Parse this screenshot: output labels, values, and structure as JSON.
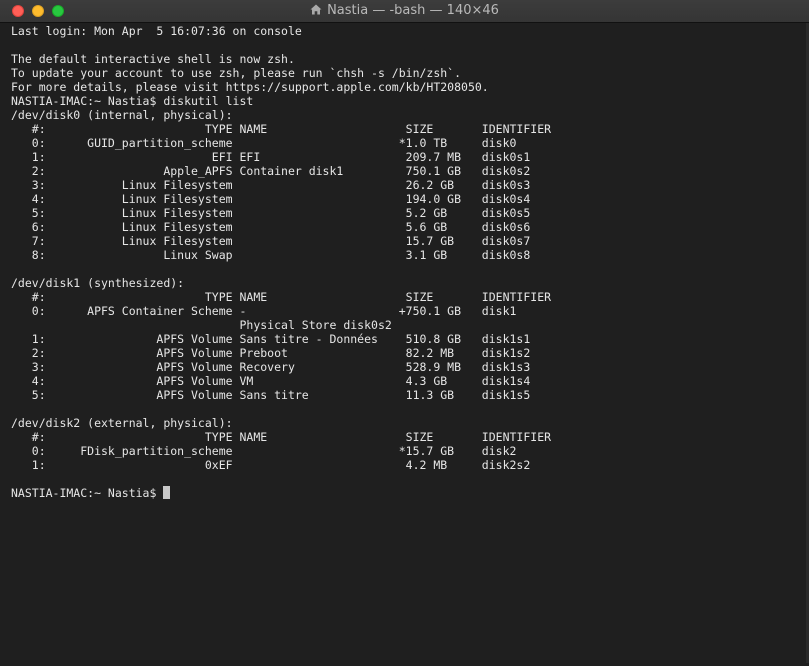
{
  "window": {
    "title": "Nastia — -bash — 140×46",
    "home_icon": "home-icon"
  },
  "terminal": {
    "lines": [
      "Last login: Mon Apr  5 16:07:36 on console",
      "",
      "The default interactive shell is now zsh.",
      "To update your account to use zsh, please run `chsh -s /bin/zsh`.",
      "For more details, please visit https://support.apple.com/kb/HT208050.",
      "NASTIA-IMAC:~ Nastia$ diskutil list",
      "/dev/disk0 (internal, physical):",
      "   #:                       TYPE NAME                    SIZE       IDENTIFIER",
      "   0:      GUID_partition_scheme                        *1.0 TB     disk0",
      "   1:                        EFI EFI                     209.7 MB   disk0s1",
      "   2:                 Apple_APFS Container disk1         750.1 GB   disk0s2",
      "   3:           Linux Filesystem                         26.2 GB    disk0s3",
      "   4:           Linux Filesystem                         194.0 GB   disk0s4",
      "   5:           Linux Filesystem                         5.2 GB     disk0s5",
      "   6:           Linux Filesystem                         5.6 GB     disk0s6",
      "   7:           Linux Filesystem                         15.7 GB    disk0s7",
      "   8:                 Linux Swap                         3.1 GB     disk0s8",
      "",
      "/dev/disk1 (synthesized):",
      "   #:                       TYPE NAME                    SIZE       IDENTIFIER",
      "   0:      APFS Container Scheme -                      +750.1 GB   disk1",
      "                                 Physical Store disk0s2",
      "   1:                APFS Volume Sans titre - Données    510.8 GB   disk1s1",
      "   2:                APFS Volume Preboot                 82.2 MB    disk1s2",
      "   3:                APFS Volume Recovery                528.9 MB   disk1s3",
      "   4:                APFS Volume VM                      4.3 GB     disk1s4",
      "   5:                APFS Volume Sans titre              11.3 GB    disk1s5",
      "",
      "/dev/disk2 (external, physical):",
      "   #:                       TYPE NAME                    SIZE       IDENTIFIER",
      "   0:     FDisk_partition_scheme                        *15.7 GB    disk2",
      "   1:                       0xEF                         4.2 MB     disk2s2",
      "",
      "NASTIA-IMAC:~ Nastia$ "
    ]
  }
}
